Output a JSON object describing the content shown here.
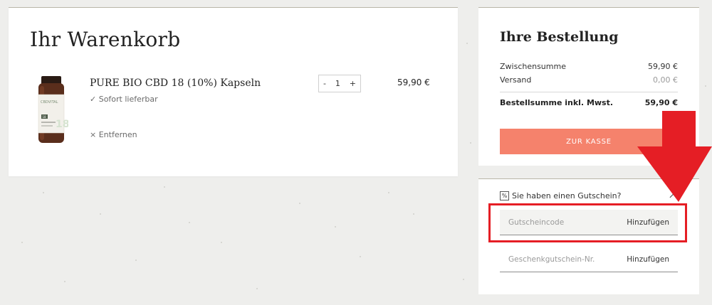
{
  "cart": {
    "title": "Ihr Warenkorb",
    "item": {
      "name": "PURE BIO CBD 18 (10%) Kapseln",
      "availability": "✓ Sofort lieferbar",
      "remove": "× Entfernen",
      "quantity": "1",
      "qty_minus": "-",
      "qty_plus": "+",
      "price": "59,90 €",
      "image_brand": "CBDVITAL"
    }
  },
  "order": {
    "title": "Ihre Bestellung",
    "rows": [
      {
        "label": "Zwischensumme",
        "value": "59,90 €"
      },
      {
        "label": "Versand",
        "value": "0,00 €"
      }
    ],
    "total": {
      "label": "Bestellsumme inkl. Mwst.",
      "value": "59,90 €"
    },
    "checkout": "ZUR KASSE"
  },
  "voucher": {
    "icon_text": "%",
    "heading": "Sie haben einen Gutschein?",
    "coupon_placeholder": "Gutscheincode",
    "coupon_button": "Hinzufügen",
    "gift_placeholder": "Geschenkgutschein-Nr.",
    "gift_button": "Hinzufügen"
  },
  "colors": {
    "checkout_button": "#f5826c",
    "annotation": "#e51e25",
    "background": "#eeeeec"
  },
  "icons": {
    "product": "supplement-bottle-icon",
    "voucher": "percent-icon",
    "expand": "chevron-up-icon",
    "annotation": "arrow-down-icon"
  }
}
